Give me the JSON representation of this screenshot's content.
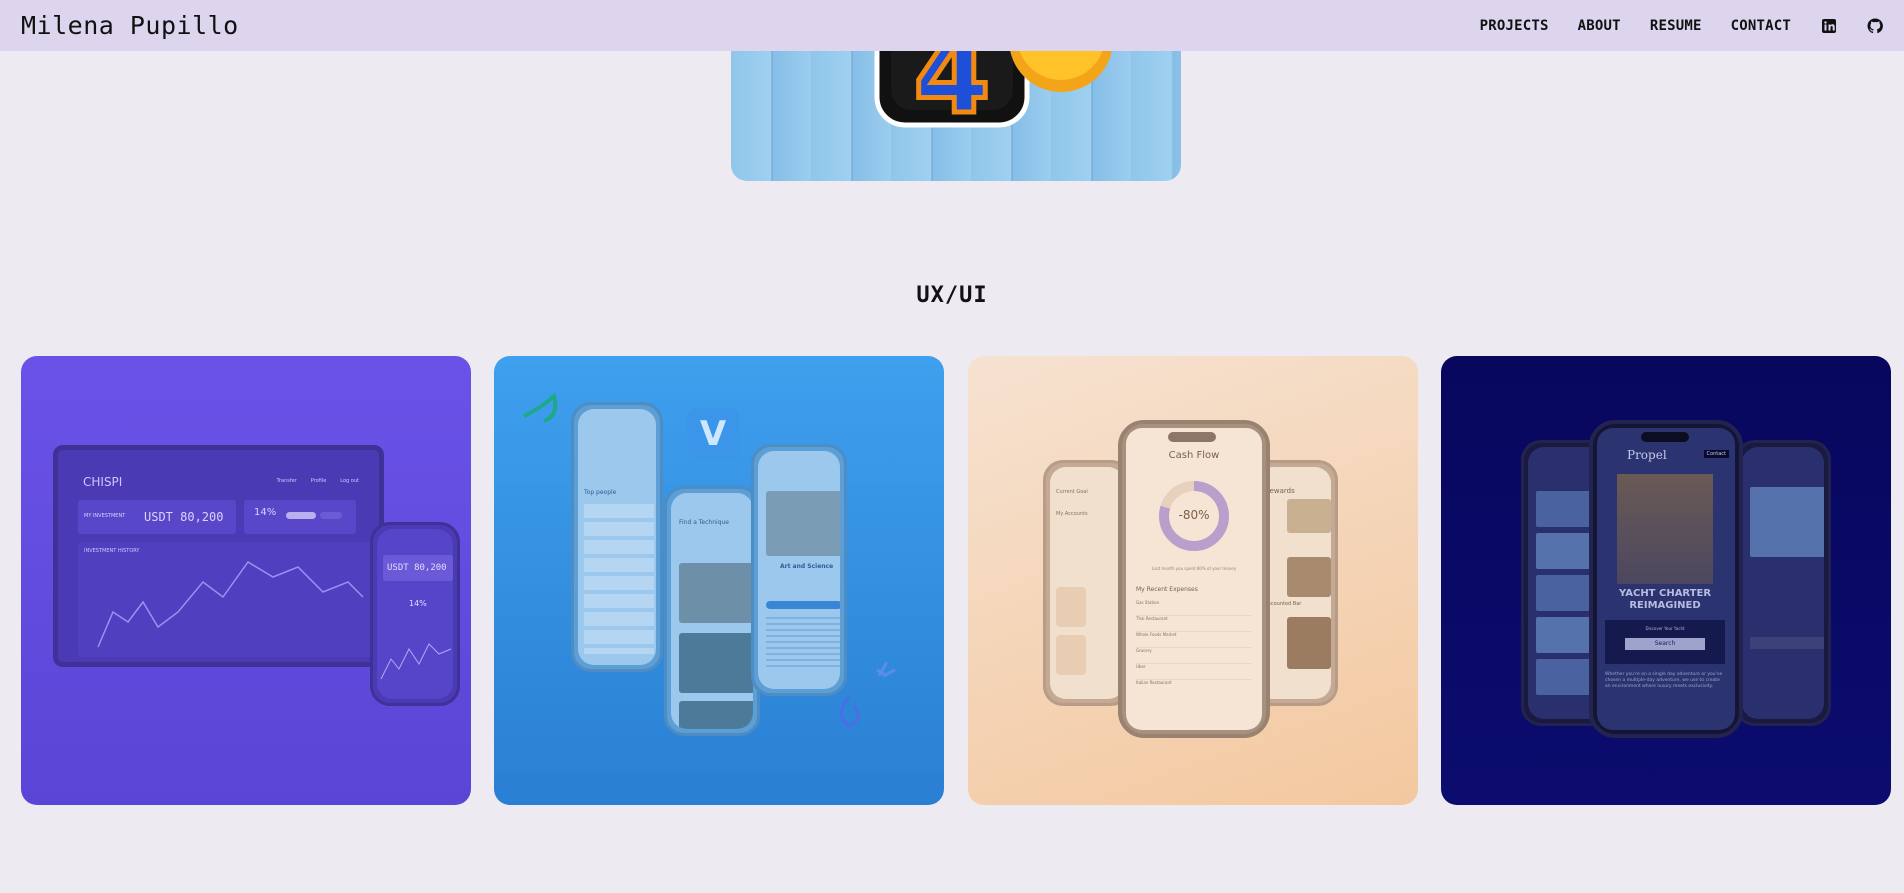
{
  "header": {
    "brand": "Milena Pupillo",
    "nav": [
      "PROJECTS",
      "ABOUT",
      "RESUME",
      "CONTACT"
    ],
    "icons": [
      "linkedin-icon",
      "github-icon"
    ]
  },
  "section": {
    "title": "UX/UI"
  },
  "cards": {
    "chispi": {
      "logo": "CHISPI",
      "menu": [
        "Transfer",
        "Profile",
        "Log out"
      ],
      "investment_label": "MY INVESTMENT",
      "investment_value": "USDT 80,200",
      "percent": "14%",
      "history_label": "INVESTMENT HISTORY",
      "phone_value": "USDT 80,200",
      "phone_percent": "14%"
    },
    "venmo": {
      "logo": "V",
      "title": "Find a Technique",
      "article": "Art and Science",
      "list_header": "Top people"
    },
    "cashflow": {
      "title": "Cash Flow",
      "percent": "-80%",
      "subtitle": "Last month you spent 80% of your money",
      "expenses_title": "My Recent Expenses",
      "expenses": [
        "Gas Station",
        "Thai Restaurant",
        "Whole Foods Market",
        "Grocery",
        "Uber",
        "Italian Restaurant"
      ],
      "left_labels": [
        "Current Goal",
        "My Accounts"
      ],
      "right_title": "Rewards",
      "right_label": "Discounted Bar"
    },
    "propel": {
      "brand": "Propel",
      "contact": "Contact",
      "hero": "YACHT CHARTER REIMAGINED",
      "cta_label": "Discover Your Yacht",
      "search": "Search",
      "body": "Whether you're on a single day adventure or you've chosen a multiple-day adventure, we use to create an environment where luxury meets exclusivity."
    }
  },
  "colors": {
    "header_bg": "#ddd4ee",
    "page_bg": "#edeaf2",
    "card_chispi": "#6a52e8",
    "card_venmo": "#3ea0ee",
    "card_cashflow": "#f5d7bb",
    "card_propel": "#07075e"
  }
}
